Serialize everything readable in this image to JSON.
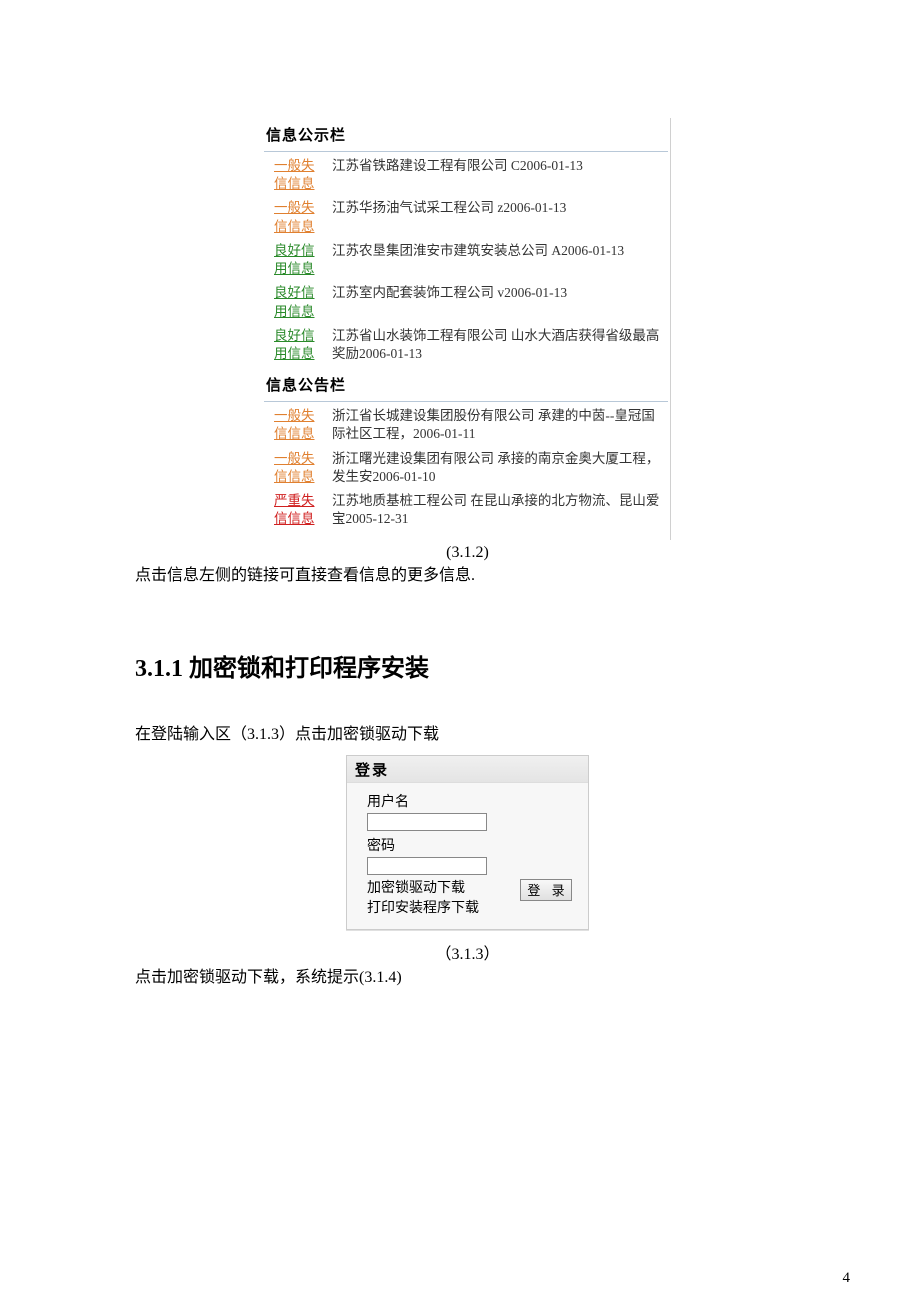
{
  "panel1": {
    "title": "信息公示栏",
    "items": [
      {
        "tag": "一般失信信息",
        "cls": "orange",
        "desc": "江苏省铁路建设工程有限公司 C2006-01-13"
      },
      {
        "tag": "一般失信信息",
        "cls": "orange",
        "desc": "江苏华扬油气试采工程公司 z2006-01-13"
      },
      {
        "tag": "良好信用信息",
        "cls": "green",
        "desc": "江苏农垦集团淮安市建筑安装总公司 A2006-01-13"
      },
      {
        "tag": "良好信用信息",
        "cls": "green",
        "desc": "江苏室内配套装饰工程公司 v2006-01-13"
      },
      {
        "tag": "良好信用信息",
        "cls": "green",
        "desc": "江苏省山水装饰工程有限公司 山水大酒店获得省级最高奖励2006-01-13"
      }
    ]
  },
  "panel2": {
    "title": "信息公告栏",
    "items": [
      {
        "tag": "一般失信信息",
        "cls": "orange",
        "desc": "浙江省长城建设集团股份有限公司 承建的中茵--皇冠国际社区工程，2006-01-11"
      },
      {
        "tag": "一般失信信息",
        "cls": "orange",
        "desc": "浙江曙光建设集团有限公司 承接的南京金奥大厦工程，发生安2006-01-10"
      },
      {
        "tag": "严重失信信息",
        "cls": "red",
        "desc": "江苏地质基桩工程公司 在昆山承接的北方物流、昆山爱宝2005-12-31"
      }
    ]
  },
  "caption1": "(3.1.2)",
  "body1": "点击信息左侧的链接可直接查看信息的更多信息.",
  "heading": "3.1.1 加密锁和打印程序安装",
  "body2": "在登陆输入区（3.1.3）点击加密锁驱动下载",
  "login": {
    "title": "登录",
    "user_label": "用户名",
    "pass_label": "密码",
    "link1": "加密锁驱动下载",
    "link2": "打印安装程序下载",
    "btn": "登 录"
  },
  "caption2": "（3.1.3）",
  "body3": "点击加密锁驱动下载，系统提示(3.1.4)",
  "page_num": "4"
}
